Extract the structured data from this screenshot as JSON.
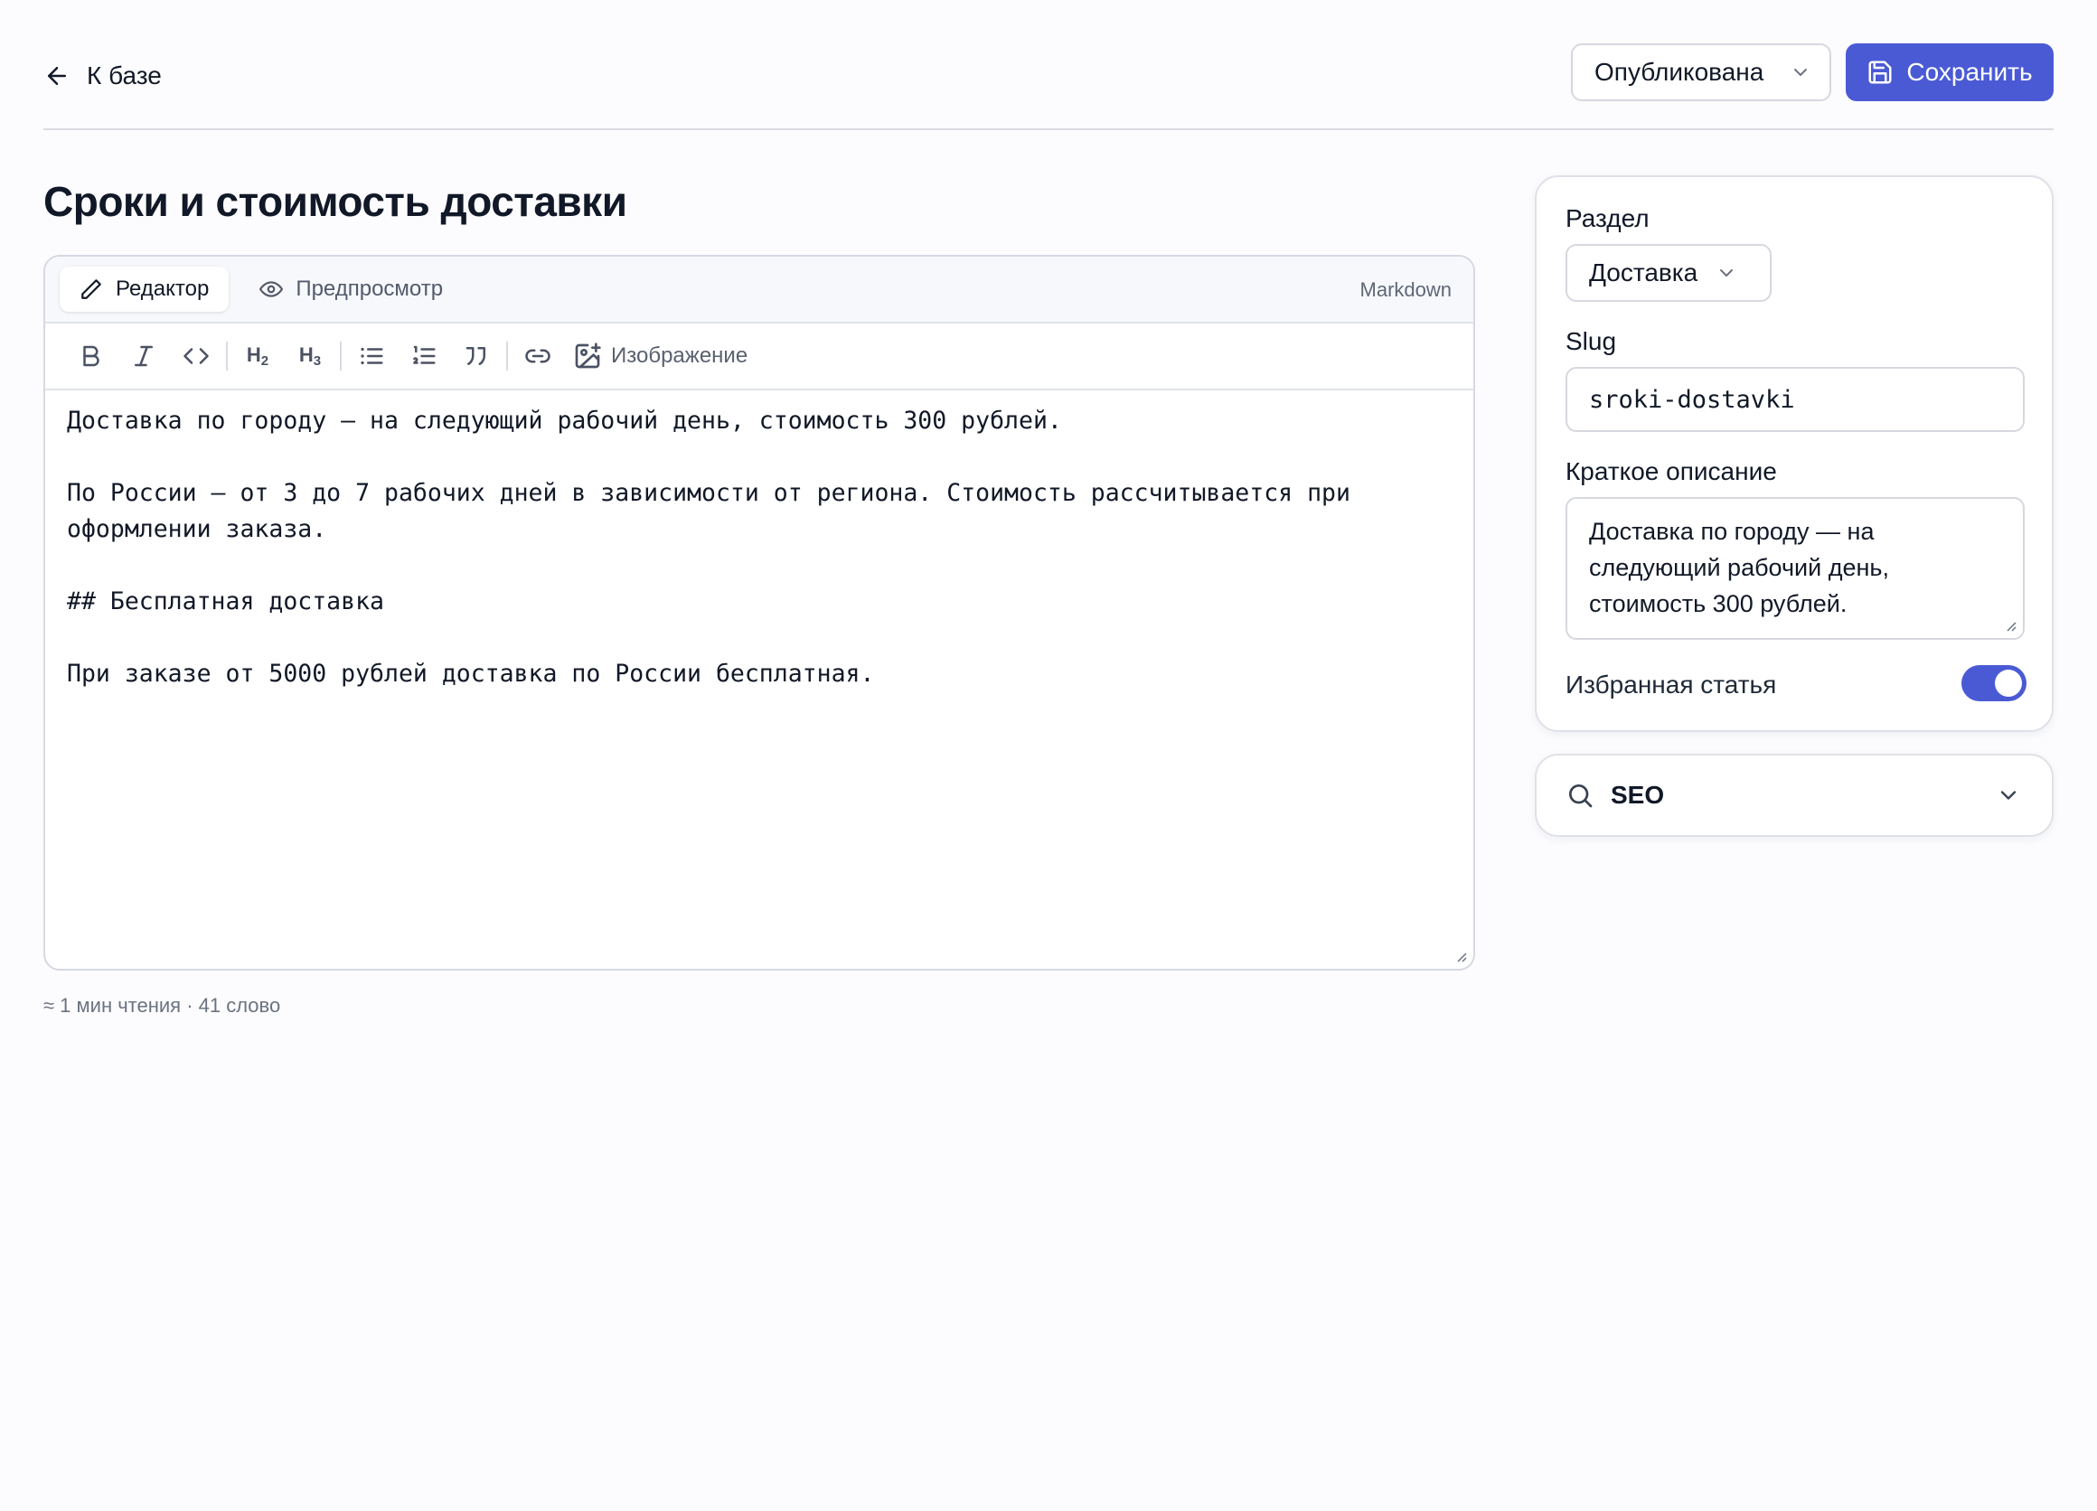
{
  "header": {
    "back_label": "К базе",
    "status_value": "Опубликована",
    "save_label": "Сохранить"
  },
  "article": {
    "title": "Сроки и стоимость доставки"
  },
  "editor": {
    "tab_editor": "Редактор",
    "tab_preview": "Предпросмотр",
    "mode_label": "Markdown",
    "toolbar": {
      "bold_icon": "bold-icon",
      "italic_icon": "italic-icon",
      "code_icon": "code-icon",
      "h2_label": "H",
      "h2_sub": "2",
      "h3_label": "H",
      "h3_sub": "3",
      "image_label": "Изображение"
    },
    "content": "Доставка по городу — на следующий рабочий день, стоимость 300 рублей.\n\nПо России — от 3 до 7 рабочих дней в зависимости от региона. Стоимость рассчитывается при оформлении заказа.\n\n## Бесплатная доставка\n\nПри заказе от 5000 рублей доставка по России бесплатная.",
    "meta": "≈ 1 мин чтения · 41 слово"
  },
  "sidebar": {
    "section_label": "Раздел",
    "section_value": "Доставка",
    "slug_label": "Slug",
    "slug_value": "sroki-dostavki",
    "summary_label": "Краткое описание",
    "summary_value": "Доставка по городу — на следующий рабочий день, стоимость 300 рублей.",
    "featured_label": "Избранная статья",
    "featured_on": true,
    "seo_label": "SEO"
  },
  "colors": {
    "accent": "#4a5ad4",
    "background": "#fcfcfe",
    "border": "#d6d8df"
  }
}
